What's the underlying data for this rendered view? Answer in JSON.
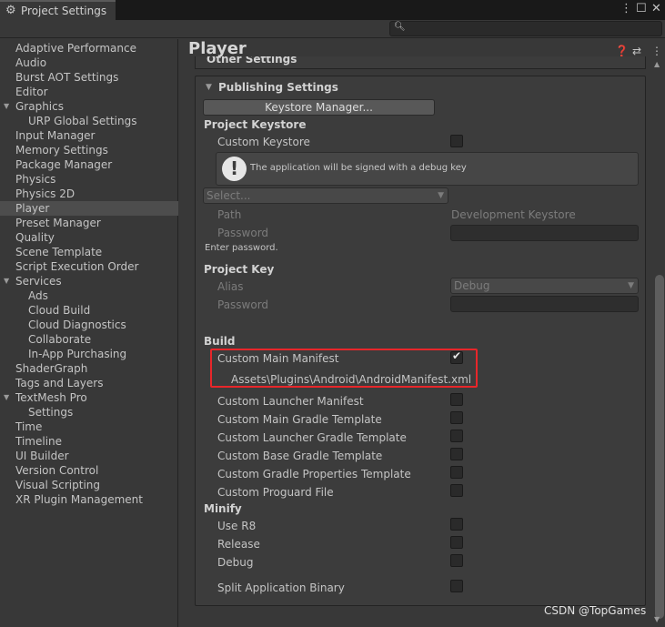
{
  "window": {
    "tab_title": "Project Settings"
  },
  "search": {
    "placeholder": ""
  },
  "sidebar": {
    "items": [
      {
        "label": "Adaptive Performance"
      },
      {
        "label": "Audio"
      },
      {
        "label": "Burst AOT Settings"
      },
      {
        "label": "Editor"
      },
      {
        "label": "Graphics"
      },
      {
        "label": "URP Global Settings"
      },
      {
        "label": "Input Manager"
      },
      {
        "label": "Memory Settings"
      },
      {
        "label": "Package Manager"
      },
      {
        "label": "Physics"
      },
      {
        "label": "Physics 2D"
      },
      {
        "label": "Player"
      },
      {
        "label": "Preset Manager"
      },
      {
        "label": "Quality"
      },
      {
        "label": "Scene Template"
      },
      {
        "label": "Script Execution Order"
      },
      {
        "label": "Services"
      },
      {
        "label": "Ads"
      },
      {
        "label": "Cloud Build"
      },
      {
        "label": "Cloud Diagnostics"
      },
      {
        "label": "Collaborate"
      },
      {
        "label": "In-App Purchasing"
      },
      {
        "label": "ShaderGraph"
      },
      {
        "label": "Tags and Layers"
      },
      {
        "label": "TextMesh Pro"
      },
      {
        "label": "Settings"
      },
      {
        "label": "Time"
      },
      {
        "label": "Timeline"
      },
      {
        "label": "UI Builder"
      },
      {
        "label": "Version Control"
      },
      {
        "label": "Visual Scripting"
      },
      {
        "label": "XR Plugin Management"
      }
    ],
    "selected": "Player"
  },
  "main": {
    "title": "Player",
    "other_settings": "Other Settings",
    "publishing": {
      "header": "Publishing Settings",
      "keystore_manager_button": "Keystore Manager...",
      "project_keystore": "Project Keystore",
      "custom_keystore": "Custom Keystore",
      "custom_keystore_checked": false,
      "help_message": "The application will be signed with a debug key",
      "select_placeholder": "Select...",
      "path_label": "Path",
      "path_value": "Development Keystore",
      "password_label": "Password",
      "enter_password": "Enter password.",
      "project_key": "Project Key",
      "alias_label": "Alias",
      "alias_value": "Debug",
      "key_password_label": "Password"
    },
    "build": {
      "header": "Build",
      "custom_main_manifest": "Custom Main Manifest",
      "custom_main_manifest_checked": true,
      "manifest_path": "Assets\\Plugins\\Android\\AndroidManifest.xml",
      "custom_launcher_manifest": "Custom Launcher Manifest",
      "custom_main_gradle_template": "Custom Main Gradle Template",
      "custom_launcher_gradle_template": "Custom Launcher Gradle Template",
      "custom_base_gradle_template": "Custom Base Gradle Template",
      "custom_gradle_properties_template": "Custom Gradle Properties Template",
      "custom_proguard_file": "Custom Proguard File"
    },
    "minify": {
      "header": "Minify",
      "use_r8": "Use R8",
      "release": "Release",
      "debug": "Debug"
    },
    "split_application_binary": "Split Application Binary"
  },
  "watermark": "CSDN @TopGames",
  "colors": {
    "background": "#383838",
    "title_bar": "#191919",
    "selection": "#4d4d4d",
    "highlight_box": "#e8262a"
  }
}
